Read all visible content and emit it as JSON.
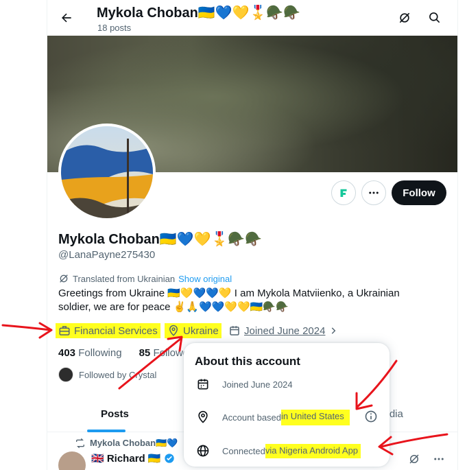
{
  "header": {
    "title": "Mykola Choban🇺🇦💙💛🎖️🪖🪖",
    "posts_count": "18 posts"
  },
  "profile": {
    "name": "Mykola Choban🇺🇦💙💛🎖️🪖🪖",
    "handle": "@LanaPayne275430",
    "follow_label": "Follow",
    "translated_label": "Translated from Ukrainian",
    "show_original_label": "Show original",
    "bio": "Greetings from Ukraine 🇺🇦💛💙💙💛 I am Mykola Matviienko, a Ukrainian soldier, we are for peace ✌️🙏💙💙💛💛🇺🇦🪖🪖",
    "category": "Financial Services",
    "location": "Ukraine",
    "joined": "Joined June 2024",
    "following_count": "403",
    "following_label": "Following",
    "followers_count": "85",
    "followers_label": "Followers",
    "followed_by": "Followed by Crystal"
  },
  "tabs": {
    "posts": "Posts",
    "media": "Media"
  },
  "post": {
    "reposted_by": "Mykola Choban🇺🇦💙",
    "author_name": "🇬🇧 Richard 🇺🇦"
  },
  "about_popup": {
    "title": "About this account",
    "joined": "Joined June 2024",
    "based_prefix": "Account based ",
    "based_hl": "in United States",
    "connected_prefix": "Connected ",
    "connected_hl": "via Nigeria Android App"
  },
  "colors": {
    "accent": "#1d9bf0",
    "highlight": "#ffff1f",
    "arrow": "#e8141c",
    "text_primary": "#0f1419",
    "text_secondary": "#536471"
  }
}
